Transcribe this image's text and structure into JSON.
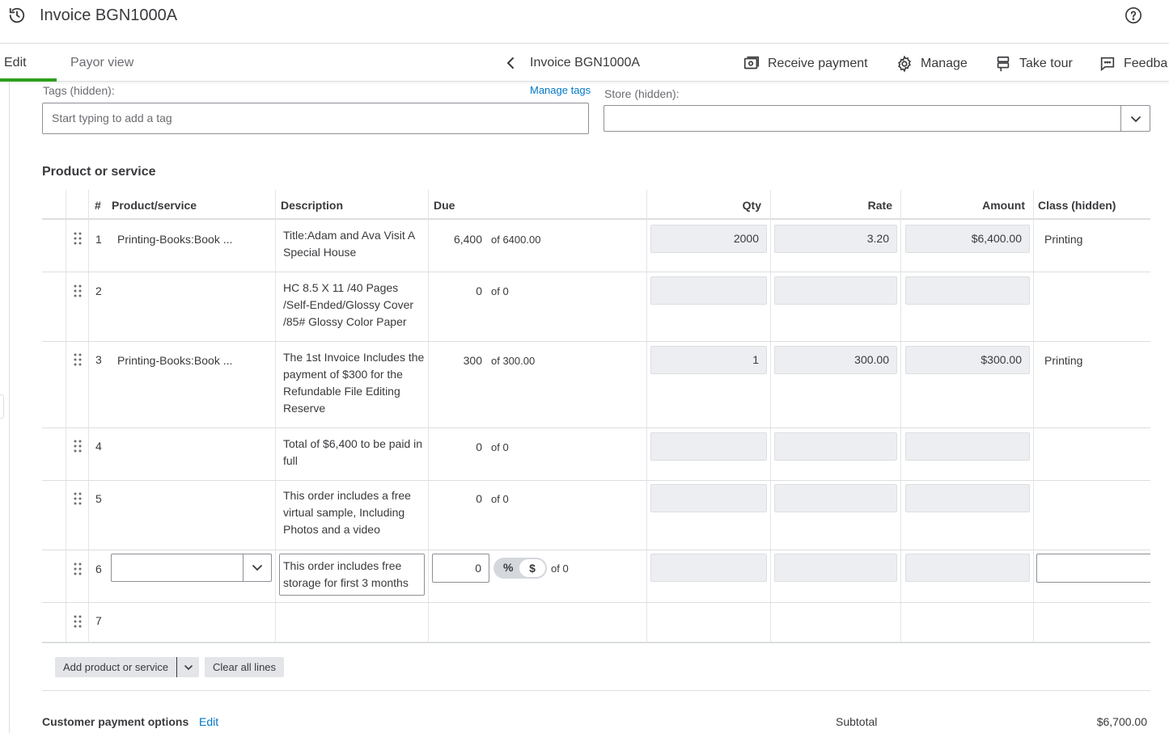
{
  "header": {
    "title": "Invoice BGN1000A"
  },
  "tabs": {
    "edit": "Edit",
    "payor_view": "Payor view"
  },
  "nav": {
    "invoice_title": "Invoice BGN1000A"
  },
  "toolbar": {
    "receive_payment": "Receive payment",
    "manage": "Manage",
    "take_tour": "Take tour",
    "feedback": "Feedba"
  },
  "fields": {
    "tags_label": "Tags (hidden):",
    "manage_tags": "Manage tags",
    "tags_placeholder": "Start typing to add a tag",
    "store_label": "Store (hidden):",
    "store_value": ""
  },
  "section": {
    "title": "Product or service"
  },
  "table": {
    "columns": {
      "num": "#",
      "product": "Product/service",
      "description": "Description",
      "due": "Due",
      "qty": "Qty",
      "rate": "Rate",
      "amount": "Amount",
      "class": "Class (hidden)"
    },
    "rows": [
      {
        "num": "1",
        "product": "Printing-Books:Book ...",
        "description": "Title:Adam and Ava Visit A Special House",
        "due": "6,400",
        "due_of": "of 6400.00",
        "qty": "2000",
        "rate": "3.20",
        "amount": "$6,400.00",
        "class": "Printing"
      },
      {
        "num": "2",
        "product": "",
        "description": "HC 8.5 X 11 /40 Pages /Self-Ended/Glossy Cover /85#  Glossy Color Paper",
        "due": "0",
        "due_of": "of 0",
        "qty": "",
        "rate": "",
        "amount": "",
        "class": ""
      },
      {
        "num": "3",
        "product": "Printing-Books:Book ...",
        "description": "The 1st Invoice Includes the payment of $300 for the Refundable File Editing Reserve",
        "due": "300",
        "due_of": "of 300.00",
        "qty": "1",
        "rate": "300.00",
        "amount": "$300.00",
        "class": "Printing"
      },
      {
        "num": "4",
        "product": "",
        "description": "Total of $6,400 to be paid in full",
        "due": "0",
        "due_of": "of 0",
        "qty": "",
        "rate": "",
        "amount": "",
        "class": ""
      },
      {
        "num": "5",
        "product": "",
        "description": "This order includes a free virtual sample, Including Photos and a video",
        "due": "0",
        "due_of": "of 0",
        "qty": "",
        "rate": "",
        "amount": "",
        "class": ""
      },
      {
        "num": "6",
        "product": "",
        "description": "This order includes free storage for first 3 months",
        "due": "0",
        "due_of": "of 0",
        "percent": "%",
        "dollar": "$",
        "qty": "",
        "rate": "",
        "amount": "",
        "class": ""
      },
      {
        "num": "7"
      }
    ]
  },
  "buttons": {
    "add_product": "Add product or service",
    "clear_lines": "Clear all lines"
  },
  "payment": {
    "title": "Customer payment options",
    "edit": "Edit"
  },
  "totals": {
    "subtotal_label": "Subtotal",
    "subtotal_value": "$6,700.00"
  },
  "colors": {
    "accent_green": "#2ca01c",
    "link_blue": "#0077c5",
    "text": "#393a3d"
  }
}
